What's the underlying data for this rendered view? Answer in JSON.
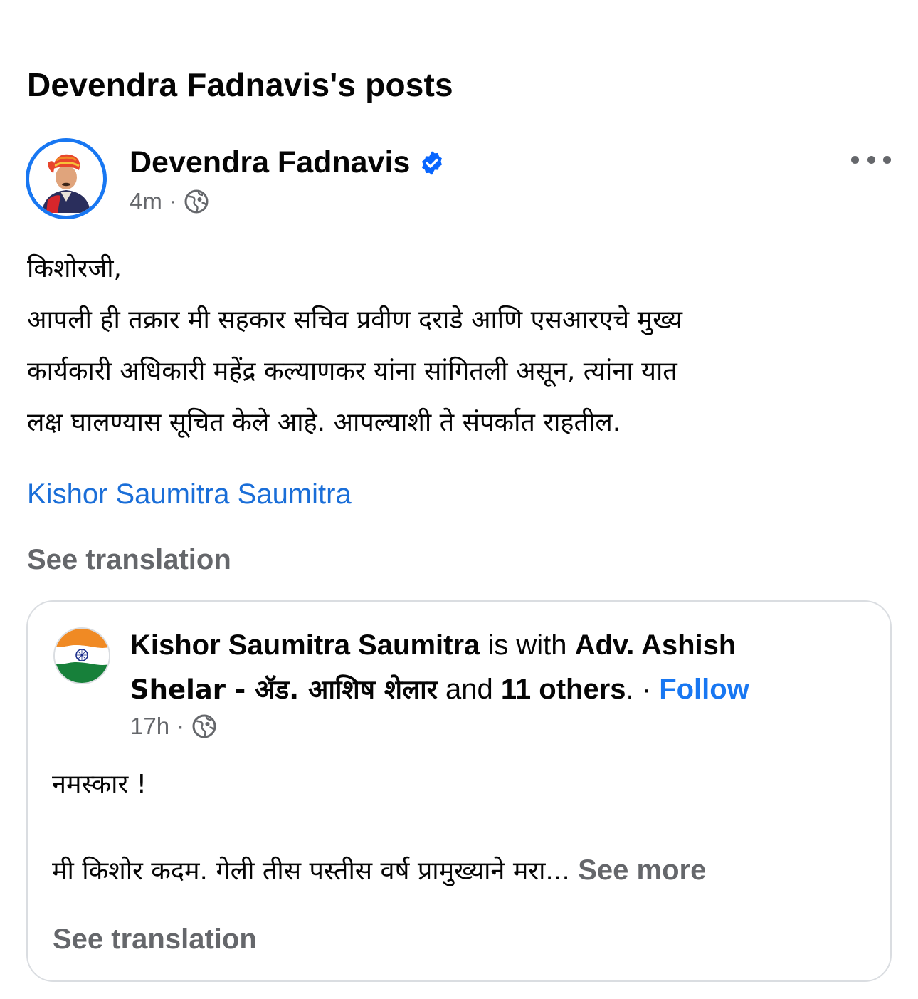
{
  "section": {
    "title": "Devendra Fadnavis's posts"
  },
  "post": {
    "author": "Devendra Fadnavis",
    "time": "4m",
    "separator": "·",
    "body_lines": [
      "किशोरजी,",
      "आपली ही तक्रार मी सहकार सचिव प्रवीण दराडे आणि एसआरएचे मुख्य",
      "कार्यकारी अधिकारी महेंद्र कल्याणकर यांना सांगितली असून, त्यांना यात",
      "लक्ष घालण्यास सूचित केले आहे. आपल्याशी ते संपर्कात राहतील."
    ],
    "mention": "Kishor Saumitra Saumitra",
    "see_translation": "See translation"
  },
  "shared": {
    "author": "Kishor Saumitra Saumitra",
    "is_with": " is with ",
    "tagged_1": "Adv. Ashish",
    "tagged_2": "Shelar - ॲड. आशिष शेलार",
    "and_text": " and ",
    "others": "11 others",
    "period_dot": ". · ",
    "follow": "Follow",
    "time": "17h",
    "separator": "·",
    "greeting": "नमस्कार !",
    "excerpt": "मी किशोर कदम. गेली तीस पस्तीस वर्ष प्रामुख्याने मरा...",
    "see_more": "See more",
    "see_translation": "See translation"
  },
  "colors": {
    "link_blue": "#1877f2",
    "meta_gray": "#65676b",
    "verified_blue": "#0866ff"
  },
  "icons": [
    "verified-badge-icon",
    "globe-icon",
    "more-options-icon",
    "india-flag-icon"
  ]
}
